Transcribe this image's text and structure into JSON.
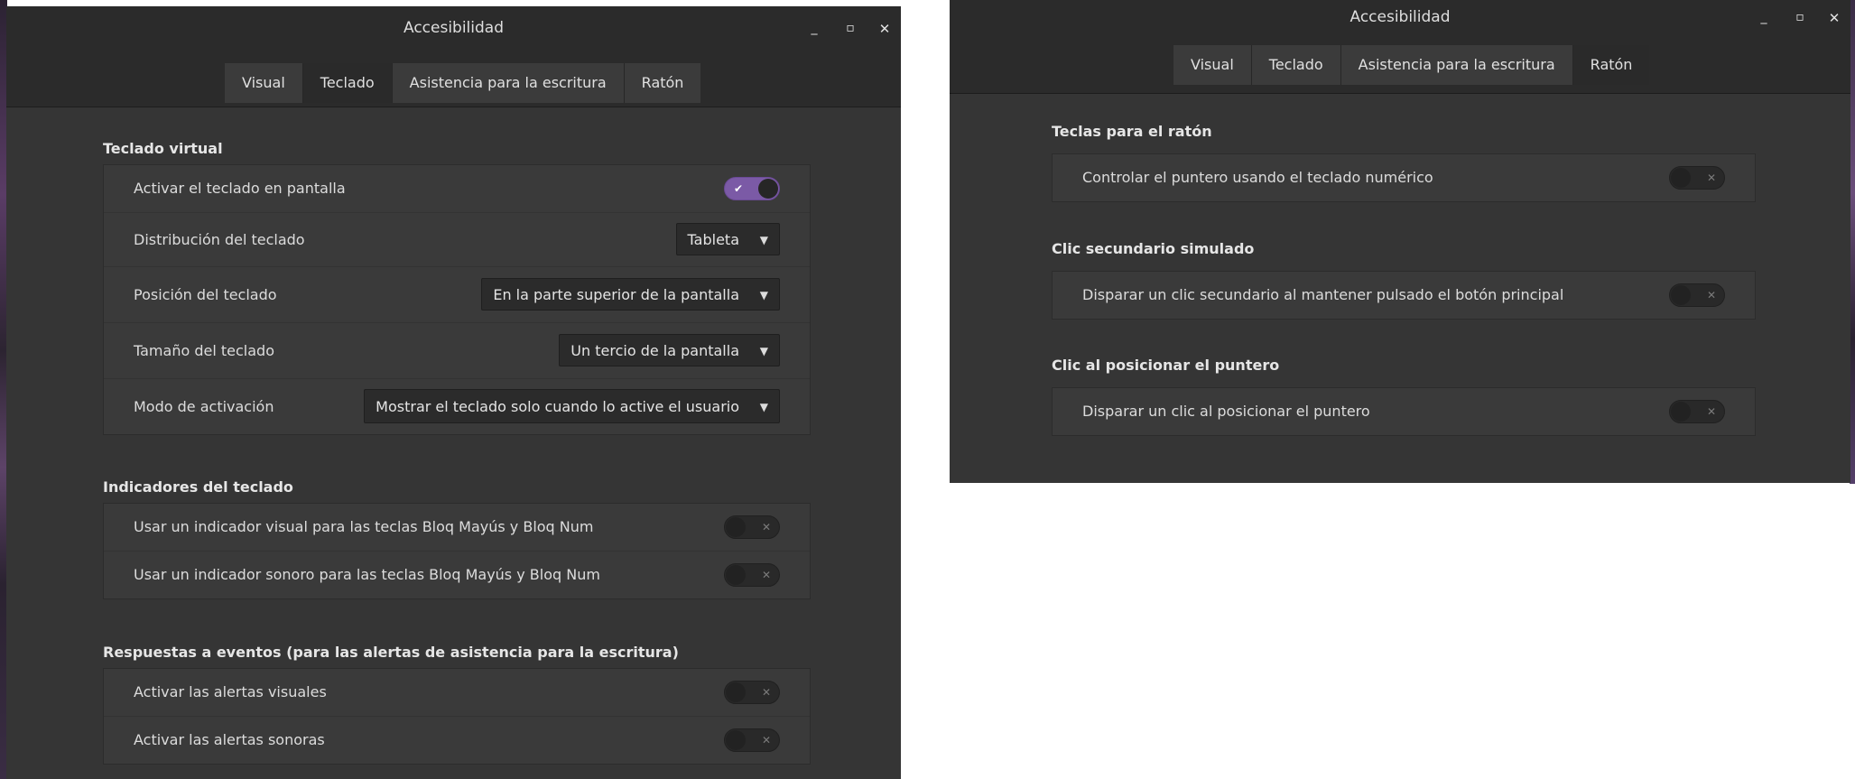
{
  "left_window": {
    "title": "Accesibilidad",
    "tabs": [
      "Visual",
      "Teclado",
      "Asistencia para la escritura",
      "Ratón"
    ],
    "active_tab": "Teclado",
    "sections": {
      "virtual_keyboard": {
        "title": "Teclado virtual",
        "enable_label": "Activar el teclado en pantalla",
        "enable_on": true,
        "layout_label": "Distribución del teclado",
        "layout_value": "Tableta",
        "position_label": "Posición del teclado",
        "position_value": "En la parte superior de la pantalla",
        "size_label": "Tamaño del teclado",
        "size_value": "Un tercio de la pantalla",
        "activation_label": "Modo de activación",
        "activation_value": "Mostrar el teclado solo cuando lo active el usuario"
      },
      "indicators": {
        "title": "Indicadores del teclado",
        "visual_label": "Usar un indicador visual para las teclas Bloq Mayús y Bloq Num",
        "sound_label": "Usar un indicador sonoro para las teclas Bloq Mayús y Bloq Num"
      },
      "event_responses": {
        "title": "Respuestas a eventos (para las alertas de asistencia para la escritura)",
        "visual_label": "Activar las alertas visuales",
        "sound_label": "Activar las alertas sonoras"
      }
    }
  },
  "right_window": {
    "title": "Accesibilidad",
    "tabs": [
      "Visual",
      "Teclado",
      "Asistencia para la escritura",
      "Ratón"
    ],
    "active_tab": "Ratón",
    "sections": {
      "mouse_keys": {
        "title": "Teclas para el ratón",
        "label": "Controlar el puntero usando el teclado numérico"
      },
      "secondary_click": {
        "title": "Clic secundario simulado",
        "label": "Disparar un clic secundario al mantener pulsado el botón principal"
      },
      "hover_click": {
        "title": "Clic al posicionar el puntero",
        "label": "Disparar un clic al posicionar el puntero"
      }
    }
  },
  "window_controls": {
    "minimize": "_",
    "maximize": "▫",
    "close": "✕"
  },
  "toggle_marks": {
    "on": "✔",
    "off": "✕"
  },
  "dropdown_caret": "▼",
  "colors": {
    "accent": "#7b5aa6",
    "window_bg": "#353535",
    "panel_bg": "#3a3a3a",
    "titlebar_bg": "#2b2b2b"
  }
}
